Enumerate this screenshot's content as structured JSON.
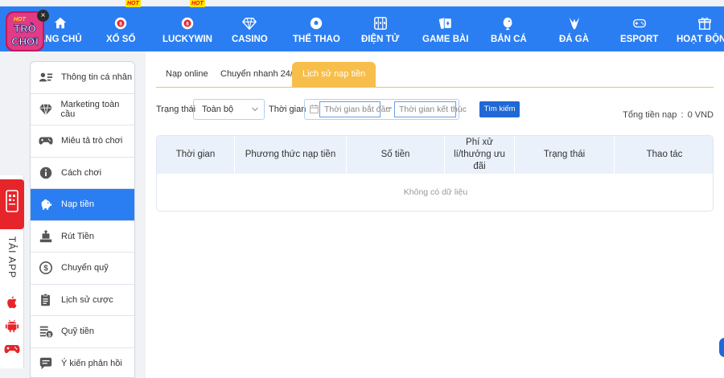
{
  "brand": {
    "logo_text_top": "TRÒ",
    "logo_text_bottom": "CHƠI",
    "logo_badge": "HOT",
    "close_glyph": "×"
  },
  "nav": [
    {
      "label": "ANG CHỦ",
      "icon": "home-icon"
    },
    {
      "label": "XỔ SỐ",
      "icon": "lottery-ball-icon",
      "badge": "HOT"
    },
    {
      "label": "LUCKYWIN",
      "icon": "lottery-ball-icon",
      "badge": "HOT"
    },
    {
      "label": "CASINO",
      "icon": "diamond-icon"
    },
    {
      "label": "THỂ THAO",
      "icon": "soccer-ball-icon"
    },
    {
      "label": "ĐIỆN TỬ",
      "icon": "slot-machine-icon"
    },
    {
      "label": "GAME BÀI",
      "icon": "playing-cards-icon"
    },
    {
      "label": "BẮN CÁ",
      "icon": "fish-icon"
    },
    {
      "label": "ĐÁ GÀ",
      "icon": "rooster-icon"
    },
    {
      "label": "ESPORT",
      "icon": "gamepad-icon"
    },
    {
      "label": "HOẠT ĐỘNG",
      "icon": "gift-icon"
    }
  ],
  "app_strip": {
    "label": "TẢI APP",
    "icons": [
      "qr-phone-icon",
      "apple-icon",
      "android-icon",
      "gamepad-icon"
    ]
  },
  "sidebar": {
    "items": [
      {
        "label": "Thông tin cá nhân",
        "icon": "user-card-icon"
      },
      {
        "label": "Marketing toàn cầu",
        "icon": "diamond-icon"
      },
      {
        "label": "Miêu tả trò chơi",
        "icon": "gamepad-icon"
      },
      {
        "label": "Cách chơi",
        "icon": "info-icon"
      },
      {
        "label": "Nạp tiền",
        "icon": "piggy-bank-icon",
        "active": true
      },
      {
        "label": "Rút Tiền",
        "icon": "withdraw-icon"
      },
      {
        "label": "Chuyển quỹ",
        "icon": "dollar-coin-icon"
      },
      {
        "label": "Lịch sử cược",
        "icon": "clipboard-icon"
      },
      {
        "label": "Quỹ tiền",
        "icon": "fund-icon"
      },
      {
        "label": "Ý kiến phản hồi",
        "icon": "feedback-icon"
      }
    ]
  },
  "tabs": [
    {
      "label": "Nạp online"
    },
    {
      "label": "Chuyển nhanh 24/7"
    },
    {
      "label": "Lịch sử nạp tiền",
      "active": true
    }
  ],
  "filters": {
    "status_label": "Trạng thái",
    "status_value": "Toàn bộ",
    "time_label": "Thời gian",
    "start_placeholder": "Thời gian bắt đầu",
    "range_separator": "--",
    "end_placeholder": "Thời gian kết thúc",
    "search_button": "Tìm kiếm"
  },
  "total": {
    "label": "Tổng tiền nạp",
    "separator": ":",
    "value": "0",
    "currency": "VND"
  },
  "table": {
    "columns": [
      "Thời gian",
      "Phương thức nạp tiền",
      "Số tiền",
      "Phí xử lí/thưởng ưu đãi",
      "Trạng thái",
      "Thao tác"
    ],
    "empty_text": "Không có dữ liệu"
  },
  "colors": {
    "primary": "#2b7ef2",
    "tab_active": "#f7be4b",
    "button": "#1f68d6",
    "app_red": "#e6252b"
  }
}
